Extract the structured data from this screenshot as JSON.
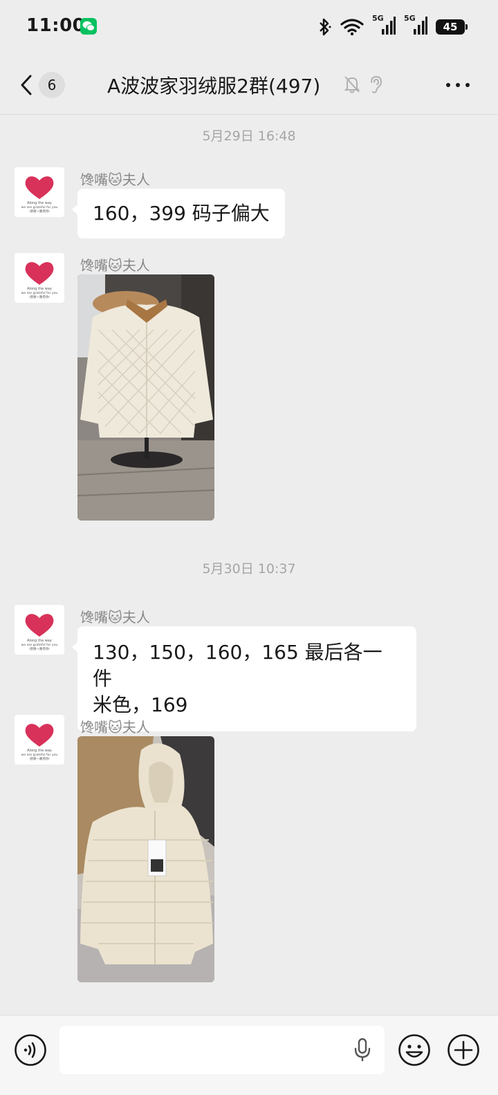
{
  "status_bar": {
    "time": "11:00",
    "battery": "45",
    "network_label_1": "5G",
    "network_label_2": "5G",
    "icons": [
      "wechat-notification-icon",
      "bluetooth-icon",
      "wifi-icon",
      "signal-icon",
      "signal-icon",
      "battery-icon"
    ]
  },
  "header": {
    "back_icon": "chevron-left-icon",
    "unread_count": "6",
    "title": "A波波家羽绒服2群(497)",
    "icons": [
      "mute-bell-icon",
      "ear-icon",
      "more-icon"
    ]
  },
  "timestamps": [
    "5月29日 16:48",
    "5月30日 10:37"
  ],
  "messages": [
    {
      "sender": "馋嘴🐱夫人",
      "type": "text",
      "text": "160，399 码子偏大"
    },
    {
      "sender": "馋嘴🐱夫人",
      "type": "image",
      "description_icon": "quilted-jacket-photo"
    },
    {
      "sender": "馋嘴🐱夫人",
      "type": "text",
      "lines": [
        "130，150，160，165 最后各一件",
        "米色，169"
      ]
    },
    {
      "sender": "馋嘴🐱夫人",
      "type": "image",
      "description_icon": "hooded-puffer-jacket-photo"
    }
  ],
  "avatar": {
    "line1": "Along the way",
    "line2": "we are grateful for you",
    "line3": "-感谢一路有你-"
  },
  "input_bar": {
    "placeholder": "",
    "icons": [
      "voice-icon",
      "mic-icon",
      "emoji-icon",
      "plus-icon"
    ]
  },
  "colors": {
    "background": "#ededed",
    "bubble": "#ffffff",
    "wechat_green": "#07c160",
    "heart_red": "#d8325a"
  }
}
